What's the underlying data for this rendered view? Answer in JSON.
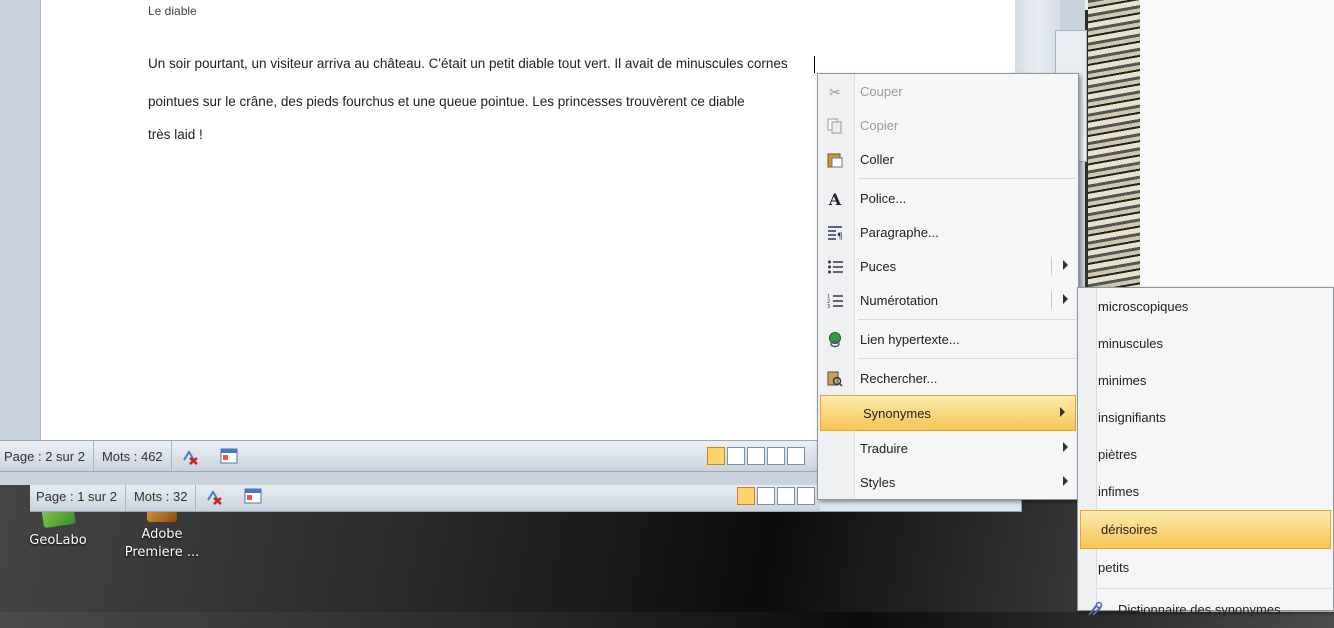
{
  "document": {
    "heading_partial": "Le diable",
    "lines": [
      "Un soir pourtant, un visiteur arriva au château. C'était un petit diable tout vert.  Il avait de  minuscules cornes",
      "pointues sur le crâne, des pieds fourchus et une queue pointue. Les princesses  trouvèrent ce diable",
      "très laid  !"
    ]
  },
  "statusbar_front": {
    "page": "Page : 2 sur 2",
    "words": "Mots : 462"
  },
  "statusbar_back": {
    "page": "Page : 1 sur 2",
    "words": "Mots : 32"
  },
  "desktop": [
    {
      "label_line1": "GeoLabo",
      "label_line2": ""
    },
    {
      "label_line1": "Adobe",
      "label_line2": "Premiere ..."
    }
  ],
  "context_menu": {
    "items": [
      {
        "label": "Couper",
        "icon": "scissors-icon",
        "disabled": true
      },
      {
        "label": "Copier",
        "icon": "copy-icon",
        "disabled": true
      },
      {
        "label": "Coller",
        "icon": "paste-icon",
        "disabled": false
      },
      {
        "label": "Police...",
        "icon": "font-icon",
        "disabled": false
      },
      {
        "label": "Paragraphe...",
        "icon": "paragraph-icon",
        "disabled": false
      },
      {
        "label": "Puces",
        "icon": "bullets-icon",
        "disabled": false,
        "submenu": true
      },
      {
        "label": "Numérotation",
        "icon": "numbering-icon",
        "disabled": false,
        "submenu": true
      },
      {
        "label": "Lien hypertexte...",
        "icon": "hyperlink-icon",
        "disabled": false
      },
      {
        "label": "Rechercher...",
        "icon": "research-icon",
        "disabled": false
      },
      {
        "label": "Synonymes",
        "icon": "",
        "disabled": false,
        "submenu": true,
        "highlighted": true
      },
      {
        "label": "Traduire",
        "icon": "",
        "disabled": false,
        "submenu": true
      },
      {
        "label": "Styles",
        "icon": "",
        "disabled": false,
        "submenu": true
      }
    ]
  },
  "synonyms_menu": {
    "items": [
      "microscopiques",
      "minuscules",
      "minimes",
      "insignifiants",
      "piètres",
      "infimes",
      "dérisoires",
      "petits"
    ],
    "highlighted": "dérisoires",
    "thesaurus_label": "Dictionnaire des synonymes..."
  },
  "colors": {
    "highlight": "#f7c552",
    "menu_bg": "#f5f6f7"
  }
}
